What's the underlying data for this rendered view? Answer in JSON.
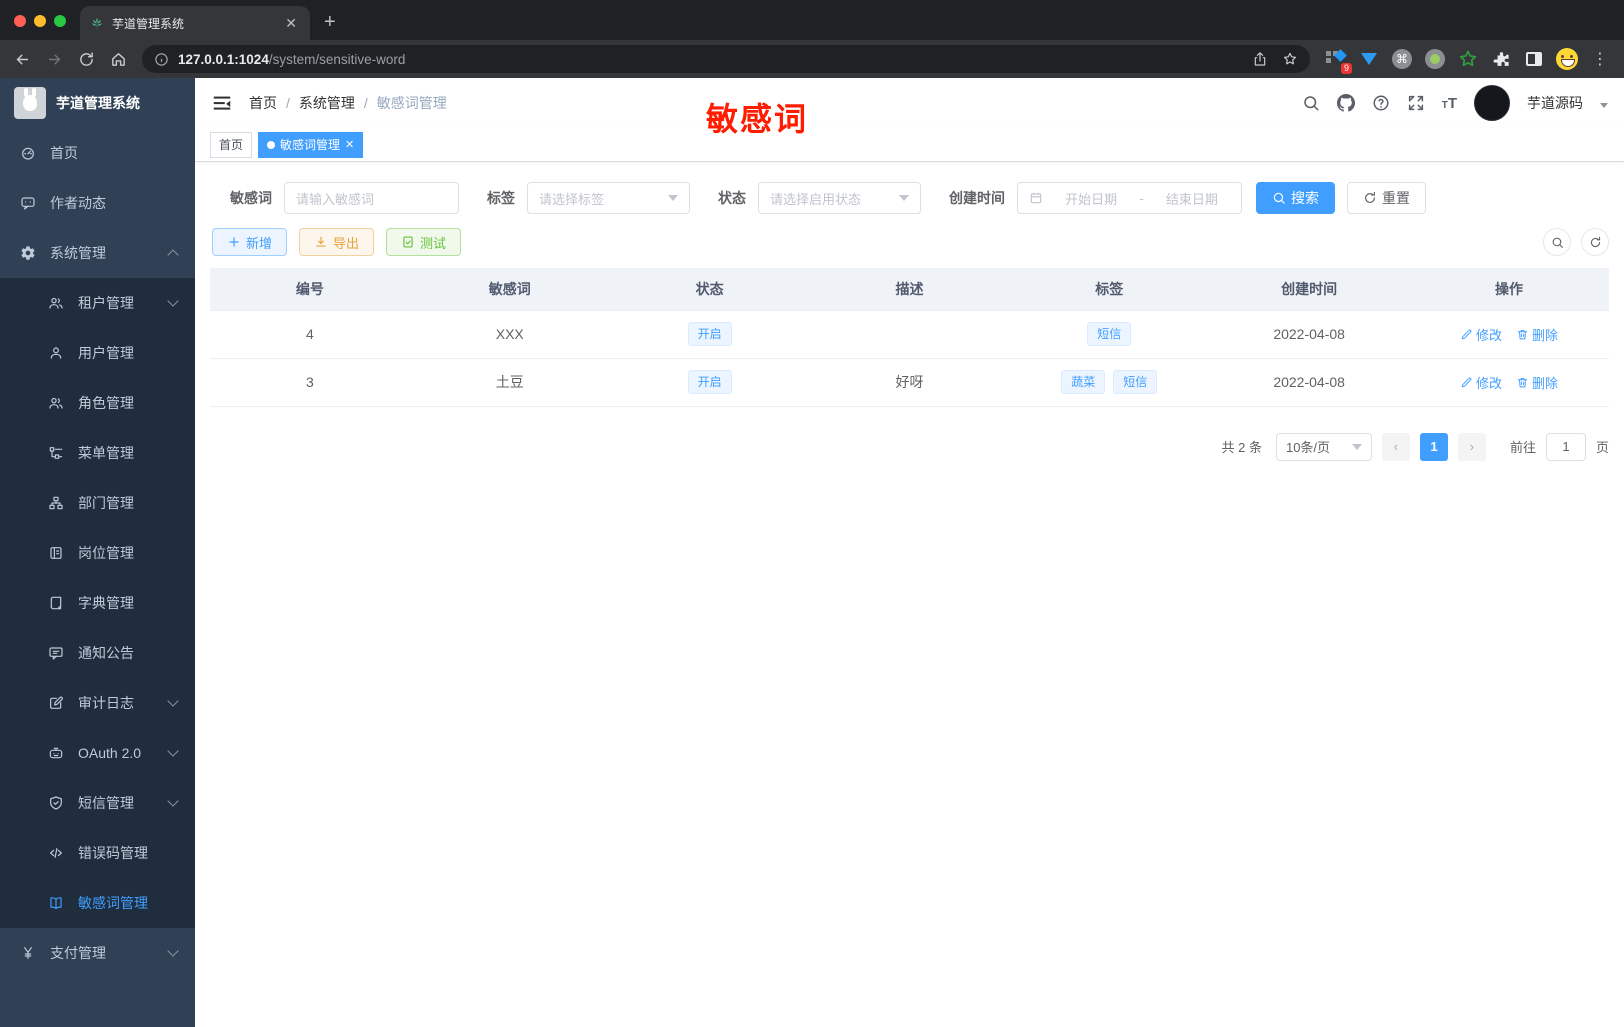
{
  "browser": {
    "tab_title": "芋道管理系统",
    "url_host": "127.0.0.1:1024",
    "url_path": "/system/sensitive-word",
    "ext_badge": "9"
  },
  "sidebar": {
    "logo_title": "芋道管理系统",
    "items": [
      {
        "icon": "dashboard",
        "label": "首页",
        "level": 1,
        "arrow": null,
        "active": false
      },
      {
        "icon": "chat",
        "label": "作者动态",
        "level": 1,
        "arrow": null,
        "active": false
      },
      {
        "icon": "gear",
        "label": "系统管理",
        "level": 1,
        "arrow": "up",
        "active": false
      },
      {
        "icon": "people",
        "label": "租户管理",
        "level": 2,
        "arrow": "down",
        "active": false
      },
      {
        "icon": "person",
        "label": "用户管理",
        "level": 2,
        "arrow": null,
        "active": false
      },
      {
        "icon": "people",
        "label": "角色管理",
        "level": 2,
        "arrow": null,
        "active": false
      },
      {
        "icon": "tree",
        "label": "菜单管理",
        "level": 2,
        "arrow": null,
        "active": false
      },
      {
        "icon": "org",
        "label": "部门管理",
        "level": 2,
        "arrow": null,
        "active": false
      },
      {
        "icon": "badge",
        "label": "岗位管理",
        "level": 2,
        "arrow": null,
        "active": false
      },
      {
        "icon": "dict",
        "label": "字典管理",
        "level": 2,
        "arrow": null,
        "active": false
      },
      {
        "icon": "comment",
        "label": "通知公告",
        "level": 2,
        "arrow": null,
        "active": false
      },
      {
        "icon": "edit",
        "label": "审计日志",
        "level": 2,
        "arrow": "down",
        "active": false
      },
      {
        "icon": "robot",
        "label": "OAuth 2.0",
        "level": 2,
        "arrow": "down",
        "active": false
      },
      {
        "icon": "shield",
        "label": "短信管理",
        "level": 2,
        "arrow": "down",
        "active": false
      },
      {
        "icon": "code",
        "label": "错误码管理",
        "level": 2,
        "arrow": null,
        "active": false
      },
      {
        "icon": "openbook",
        "label": "敏感词管理",
        "level": 2,
        "arrow": null,
        "active": true
      },
      {
        "icon": "yen",
        "label": "支付管理",
        "level": 1,
        "arrow": "down",
        "active": false
      }
    ]
  },
  "header": {
    "breadcrumb": [
      "首页",
      "系统管理",
      "敏感词管理"
    ],
    "user_name": "芋道源码"
  },
  "annotation": {
    "text": "敏感词"
  },
  "tags_view": {
    "tabs": [
      {
        "label": "首页",
        "active": false,
        "closable": false
      },
      {
        "label": "敏感词管理",
        "active": true,
        "closable": true
      }
    ]
  },
  "filters": {
    "keyword": {
      "label": "敏感词",
      "placeholder": "请输入敏感词"
    },
    "tag": {
      "label": "标签",
      "placeholder": "请选择标签"
    },
    "status": {
      "label": "状态",
      "placeholder": "请选择启用状态"
    },
    "date": {
      "label": "创建时间",
      "start_placeholder": "开始日期",
      "separator": "-",
      "end_placeholder": "结束日期"
    },
    "search_label": "搜索",
    "reset_label": "重置"
  },
  "toolbar": {
    "add_label": "新增",
    "export_label": "导出",
    "test_label": "测试"
  },
  "table": {
    "columns": [
      "编号",
      "敏感词",
      "状态",
      "描述",
      "标签",
      "创建时间",
      "操作"
    ],
    "rows": [
      {
        "id": "4",
        "word": "XXX",
        "status": "开启",
        "desc": "",
        "tags": [
          "短信"
        ],
        "created": "2022-04-08",
        "edit": "修改",
        "delete": "删除"
      },
      {
        "id": "3",
        "word": "土豆",
        "status": "开启",
        "desc": "好呀",
        "tags": [
          "蔬菜",
          "短信"
        ],
        "created": "2022-04-08",
        "edit": "修改",
        "delete": "删除"
      }
    ]
  },
  "pagination": {
    "total_text": "共 2 条",
    "page_size_text": "10条/页",
    "current_page": "1",
    "goto_label": "前往",
    "goto_value": "1",
    "goto_unit": "页"
  },
  "colors": {
    "primary": "#409eff",
    "annotation_red": "#ff1c00"
  }
}
